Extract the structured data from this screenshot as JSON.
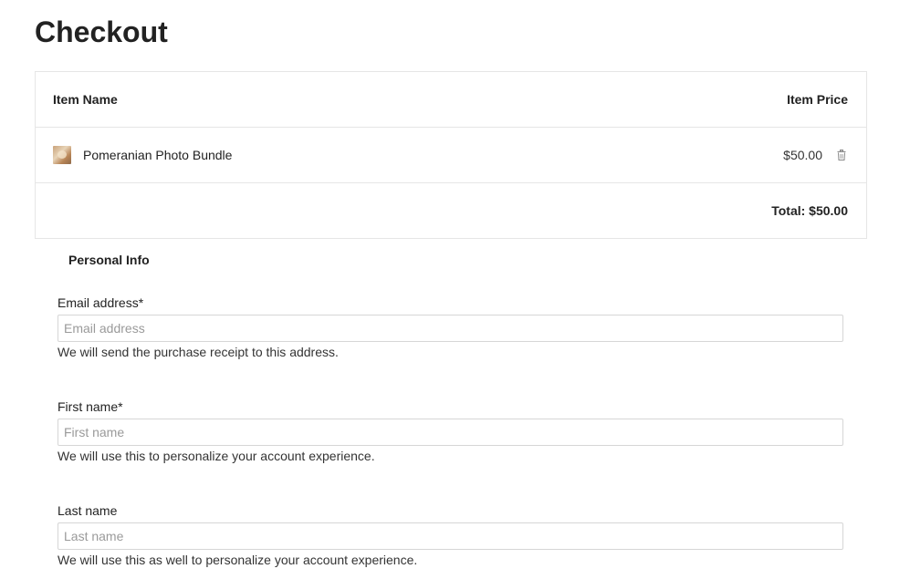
{
  "page": {
    "title": "Checkout"
  },
  "cart": {
    "headers": {
      "item_name": "Item Name",
      "item_price": "Item Price"
    },
    "items": [
      {
        "name": "Pomeranian Photo Bundle",
        "price": "$50.00",
        "thumbnail": "pomeranian-photo-thumbnail",
        "remove_icon": "trash-icon"
      }
    ],
    "total": "Total: $50.00"
  },
  "personal_info": {
    "title": "Personal Info",
    "fields": [
      {
        "label": "Email address*",
        "placeholder": "Email address",
        "value": "",
        "help": "We will send the purchase receipt to this address."
      },
      {
        "label": "First name*",
        "placeholder": "First name",
        "value": "",
        "help": "We will use this to personalize your account experience."
      },
      {
        "label": "Last name",
        "placeholder": "Last name",
        "value": "",
        "help": "We will use this as well to personalize your account experience."
      }
    ]
  },
  "colors": {
    "border": "#e6e6e6",
    "input_border": "#d6d6d6",
    "text": "#222222",
    "placeholder": "#9a9a9a",
    "icon": "#888888"
  }
}
